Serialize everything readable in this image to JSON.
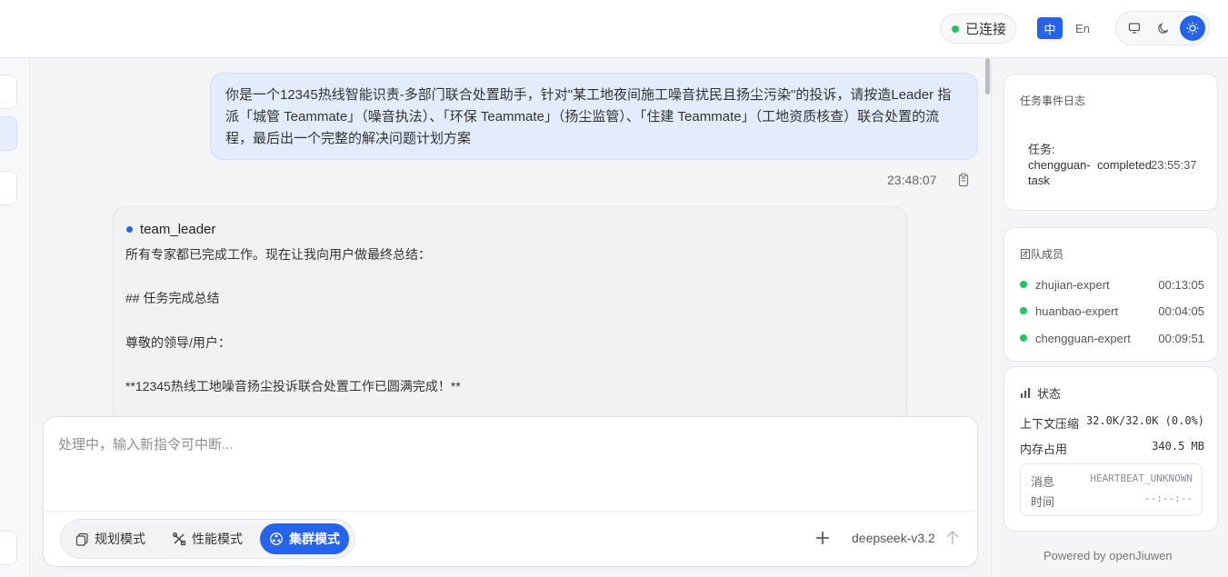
{
  "header": {
    "connection_status": "已连接",
    "status_color": "#22c55e",
    "lang_zh": "中",
    "lang_en": "En",
    "theme_buttons": [
      "monitor-icon",
      "moon-icon",
      "sun-icon"
    ],
    "active_theme": "sun-icon",
    "accent_color": "#2563eb"
  },
  "chat": {
    "user_message": "你是一个12345热线智能识责-多部门联合处置助手，针对\"某工地夜间施工噪音扰民且扬尘污染\"的投诉，请按造Leader 指派「城管 Teammate」（噪音执法）、「环保 Teammate」（扬尘监管）、「住建 Teammate」（工地资质核查）联合处置的流程，最后出一个完整的解决问题计划方案",
    "user_time": "23:48:07",
    "leader": {
      "name": "team_leader",
      "lines": [
        "所有专家都已完成工作。现在让我向用户做最终总结：",
        "## 任务完成总结",
        "尊敬的领导/用户：",
        "**12345热线工地噪音扬尘投诉联合处置工作已圆满完成！**"
      ]
    }
  },
  "composer": {
    "placeholder": "处理中，输入新指令可中断...",
    "modes": [
      {
        "label": "规划模式",
        "icon": "copy-icon"
      },
      {
        "label": "性能模式",
        "icon": "tools-icon"
      },
      {
        "label": "集群模式",
        "icon": "cluster-icon"
      }
    ],
    "active_mode": "集群模式",
    "model": "deepseek-v3.2"
  },
  "right_panel": {
    "event_log": {
      "title": "任务事件日志",
      "task": "任务: chengguan-task",
      "status": "completed",
      "time": "23:55:37"
    },
    "team": {
      "title": "团队成员",
      "members": [
        {
          "name": "zhujian-expert",
          "time": "00:13:05"
        },
        {
          "name": "huanbao-expert",
          "time": "00:04:05"
        },
        {
          "name": "chengguan-expert",
          "time": "00:09:51"
        }
      ]
    },
    "status": {
      "title": "状态",
      "context_label": "上下文压缩",
      "context_value": "32.0K/32.0K (0.0%)",
      "memory_label": "内存占用",
      "memory_value": "340.5 MB",
      "message_label": "消息",
      "message_value": "HEARTBEAT_UNKNOWN",
      "time_label": "时间",
      "time_value": "--:--:--"
    },
    "powered_by": "Powered by openJiuwen"
  }
}
